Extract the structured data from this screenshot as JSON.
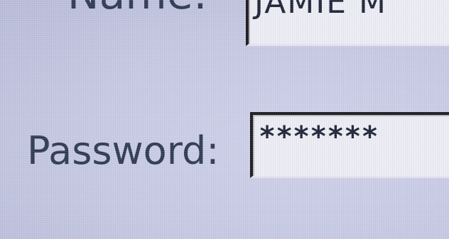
{
  "form": {
    "name_label": "Name:",
    "name_value": "JAMIE M",
    "password_label": "Password:",
    "password_value": "*******"
  },
  "colors": {
    "background": "#c9cce4",
    "label_text": "#2e3a52",
    "field_background": "#ededf4",
    "field_border": "#1a1a1a"
  }
}
